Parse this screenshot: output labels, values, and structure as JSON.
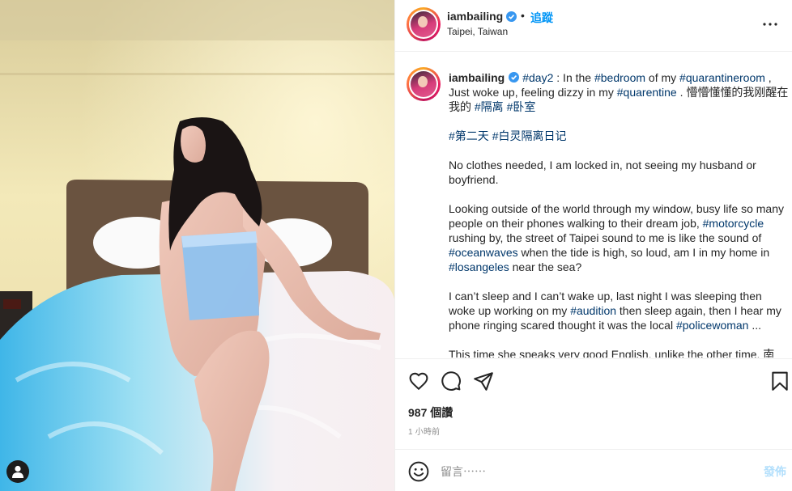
{
  "post": {
    "username": "iambailing",
    "follow_label": "追蹤",
    "location": "Taipei, Taiwan",
    "dot": "•"
  },
  "caption": {
    "username": "iambailing",
    "p1": [
      {
        "t": "#day2",
        "tag": true
      },
      {
        "t": " : In the ",
        "tag": false
      },
      {
        "t": "#bedroom",
        "tag": true
      },
      {
        "t": " of my ",
        "tag": false
      },
      {
        "t": "#quarantineroom",
        "tag": true
      },
      {
        "t": " , Just woke up, feeling dizzy in my ",
        "tag": false
      },
      {
        "t": "#quarentine",
        "tag": true
      },
      {
        "t": " . 懵懵懂懂的我刚醒在我的 ",
        "tag": false
      },
      {
        "t": "#隔离",
        "tag": true
      },
      {
        "t": " ",
        "tag": false
      },
      {
        "t": "#卧室",
        "tag": true
      }
    ],
    "p2": [
      {
        "t": "#第二天",
        "tag": true
      },
      {
        "t": " ",
        "tag": false
      },
      {
        "t": "#白灵隔离日记",
        "tag": true
      }
    ],
    "p3": [
      {
        "t": "No clothes needed, I am locked in, not seeing my husband or boyfriend.",
        "tag": false
      }
    ],
    "p4": [
      {
        "t": "Looking outside of the world through my window, busy life so many people on their phones walking to their dream job, ",
        "tag": false
      },
      {
        "t": "#motorcycle",
        "tag": true
      },
      {
        "t": " rushing by, the street of Taipei sound to me is like the sound of ",
        "tag": false
      },
      {
        "t": "#oceanwaves",
        "tag": true
      },
      {
        "t": " when the tide is high, so loud, am I in my home in ",
        "tag": false
      },
      {
        "t": "#losangeles",
        "tag": true
      },
      {
        "t": " near the sea?",
        "tag": false
      }
    ],
    "p5": [
      {
        "t": "I can’t sleep and I can’t wake up, last night I was sleeping then woke up working on my ",
        "tag": false
      },
      {
        "t": "#audition",
        "tag": true
      },
      {
        "t": " then sleep again, then I hear my phone ringing scared thought it was the local ",
        "tag": false
      },
      {
        "t": "#policewoman",
        "tag": true
      },
      {
        "t": " ...",
        "tag": false
      }
    ],
    "p6": [
      {
        "t": "This time she speaks very good English, unlike the other time, 南",
        "tag": false
      }
    ]
  },
  "stats": {
    "likes": "987 個讚",
    "time": "1 小時前"
  },
  "comment": {
    "placeholder": "留言⋯⋯",
    "post_label": "發佈"
  },
  "icons": {
    "heart": "heart-icon",
    "comment": "comment-icon",
    "share": "share-icon",
    "save": "bookmark-icon",
    "emoji": "emoji-icon",
    "more": "more-options-icon",
    "verified": "verified-badge-icon",
    "user_tag": "user-tag-icon"
  },
  "colors": {
    "link": "#00376b",
    "follow": "#0095f6",
    "verified": "#3897f0",
    "post_disabled": "#b2dffc",
    "muted": "#8e8e8e"
  }
}
